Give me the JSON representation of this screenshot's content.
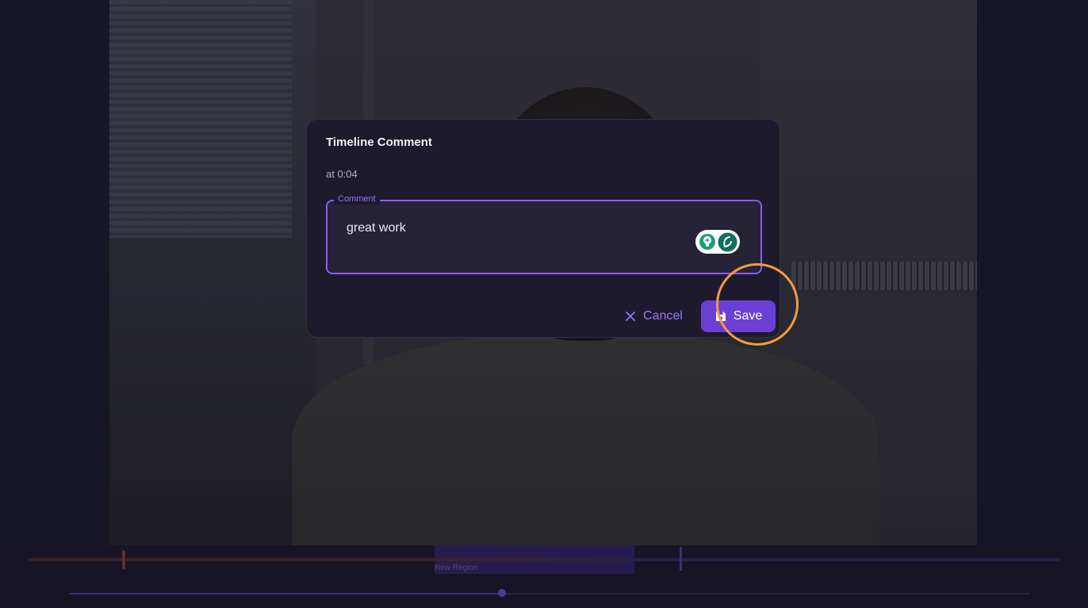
{
  "dialog": {
    "title": "Timeline Comment",
    "subtitle": "at 0:04",
    "comment_label": "Comment",
    "comment_value": "great work",
    "cancel_label": "Cancel",
    "save_label": "Save"
  },
  "timeline": {
    "region_label": "New Region",
    "playhead_fraction": 0.45
  },
  "icons": {
    "cancel": "close-icon",
    "save": "floppy-disk-icon",
    "extension": "grammar-extension-icon"
  },
  "colors": {
    "accent": "#8c5cf0",
    "save_button": "#6b3fd4",
    "click_indicator": "#f39a3e",
    "extension_green": "#1f9e74"
  }
}
